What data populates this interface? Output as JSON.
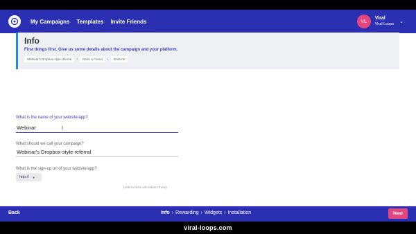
{
  "colors": {
    "primary": "#2b2fb1",
    "accent": "#e3467f",
    "info_border": "#2a86e6"
  },
  "topbar": {
    "logo_icon": "viral-loops-logo-icon",
    "nav": [
      "My Campaigns",
      "Templates",
      "Invite Friends"
    ],
    "user": {
      "initials": "VL",
      "name": "Viral",
      "org": "Viral Loops"
    }
  },
  "info": {
    "title": "Info",
    "subtitle": "First things first. Give us some details about the campaign and your platform.",
    "crumbs": [
      "Webinar's Dropbox-style referral",
      "Refer a Friend",
      "#referral"
    ]
  },
  "form": {
    "website_label": "What is the name of your website/app?",
    "website_value": "Webinar",
    "campaign_label": "What should we call your campaign?",
    "campaign_value": "Webinar's Dropbox-style referral",
    "signup_label": "What is the sign-up url of your website/app?",
    "protocol": "http://",
    "hint": "(referral links will redirect there)"
  },
  "footer": {
    "back": "Back",
    "steps": [
      "Info",
      "Rewarding",
      "Widgets",
      "Installation"
    ],
    "next": "Next"
  },
  "watermark": "viral-loops.com"
}
